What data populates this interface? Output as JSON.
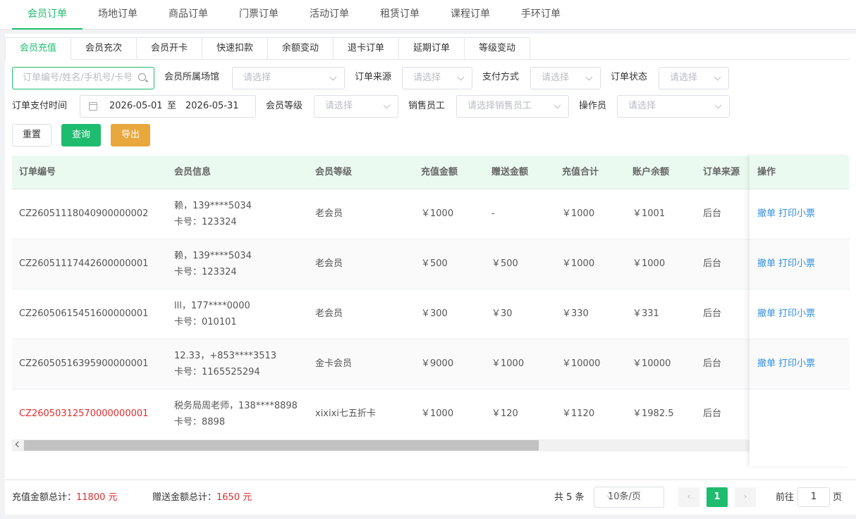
{
  "top_tabs": [
    "会员订单",
    "场地订单",
    "商品订单",
    "门票订单",
    "活动订单",
    "租赁订单",
    "课程订单",
    "手环订单"
  ],
  "sub_tabs": [
    "会员充值",
    "会员充次",
    "会员开卡",
    "快速扣款",
    "余额变动",
    "退卡订单",
    "延期订单",
    "等级变动"
  ],
  "filters": {
    "search_placeholder": "订单编号/姓名/手机号/卡号",
    "venue_label": "会员所属场馆",
    "venue_placeholder": "请选择",
    "source_label": "订单来源",
    "source_placeholder": "请选择",
    "pay_label": "支付方式",
    "pay_placeholder": "请选择",
    "status_label": "订单状态",
    "status_placeholder": "请选择",
    "paytime_label": "订单支付时间",
    "date_start": "2026-05-01",
    "date_sep": "至",
    "date_end": "2026-05-31",
    "level_label": "会员等级",
    "level_placeholder": "请选择",
    "sales_label": "销售员工",
    "sales_placeholder": "请选择销售员工",
    "operator_label": "操作员",
    "operator_placeholder": "请选择"
  },
  "buttons": {
    "reset": "重置",
    "query": "查询",
    "export": "导出"
  },
  "table": {
    "headers": [
      "订单编号",
      "会员信息",
      "会员等级",
      "充值金额",
      "赠送金额",
      "充值合计",
      "账户余额",
      "订单来源",
      "操作"
    ],
    "rows": [
      {
        "order_no": "CZ26051118040900000002",
        "member_line1": "赖，139****5034",
        "member_line2": "卡号：123324",
        "level": "老会员",
        "recharge": "￥1000",
        "gift": "-",
        "total": "￥1000",
        "balance": "￥1001",
        "source": "后台",
        "op1": "撤单",
        "op2": "打印小票"
      },
      {
        "order_no": "CZ26051117442600000001",
        "member_line1": "赖，139****5034",
        "member_line2": "卡号：123324",
        "level": "老会员",
        "recharge": "￥500",
        "gift": "￥500",
        "total": "￥1000",
        "balance": "￥1000",
        "source": "后台",
        "op1": "撤单",
        "op2": "打印小票"
      },
      {
        "order_no": "CZ26050615451600000001",
        "member_line1": "lll，177****0000",
        "member_line2": "卡号：010101",
        "level": "老会员",
        "recharge": "￥300",
        "gift": "￥30",
        "total": "￥330",
        "balance": "￥331",
        "source": "后台",
        "op1": "撤单",
        "op2": "打印小票"
      },
      {
        "order_no": "CZ26050516395900000001",
        "member_line1": "12.33，+853****3513",
        "member_line2": "卡号：1165525294",
        "level": "金卡会员",
        "recharge": "￥9000",
        "gift": "￥1000",
        "total": "￥10000",
        "balance": "￥10000",
        "source": "后台",
        "op1": "撤单",
        "op2": "打印小票"
      },
      {
        "order_no": "CZ26050312570000000001",
        "member_line1": "税务局周老师，138****8898",
        "member_line2": "卡号：8898",
        "level": "xixixi七五折卡",
        "recharge": "￥1000",
        "gift": "￥120",
        "total": "￥1120",
        "balance": "￥1982.5",
        "source": "后台",
        "op1": "",
        "op2": ""
      }
    ]
  },
  "footer": {
    "recharge_total_label": "充值金额总计：",
    "recharge_total_value": "11800 元",
    "gift_total_label": "赠送金额总计：",
    "gift_total_value": "1650 元",
    "count": "共 5 条",
    "page_size": "10条/页",
    "current_page": "1",
    "goto_label": "前往",
    "goto_value": "1",
    "page_suffix": "页"
  },
  "colors": {
    "accent": "#1ebc6e",
    "warning": "#e8a83e",
    "danger": "#e02d2d",
    "link": "#2f8ee0"
  }
}
